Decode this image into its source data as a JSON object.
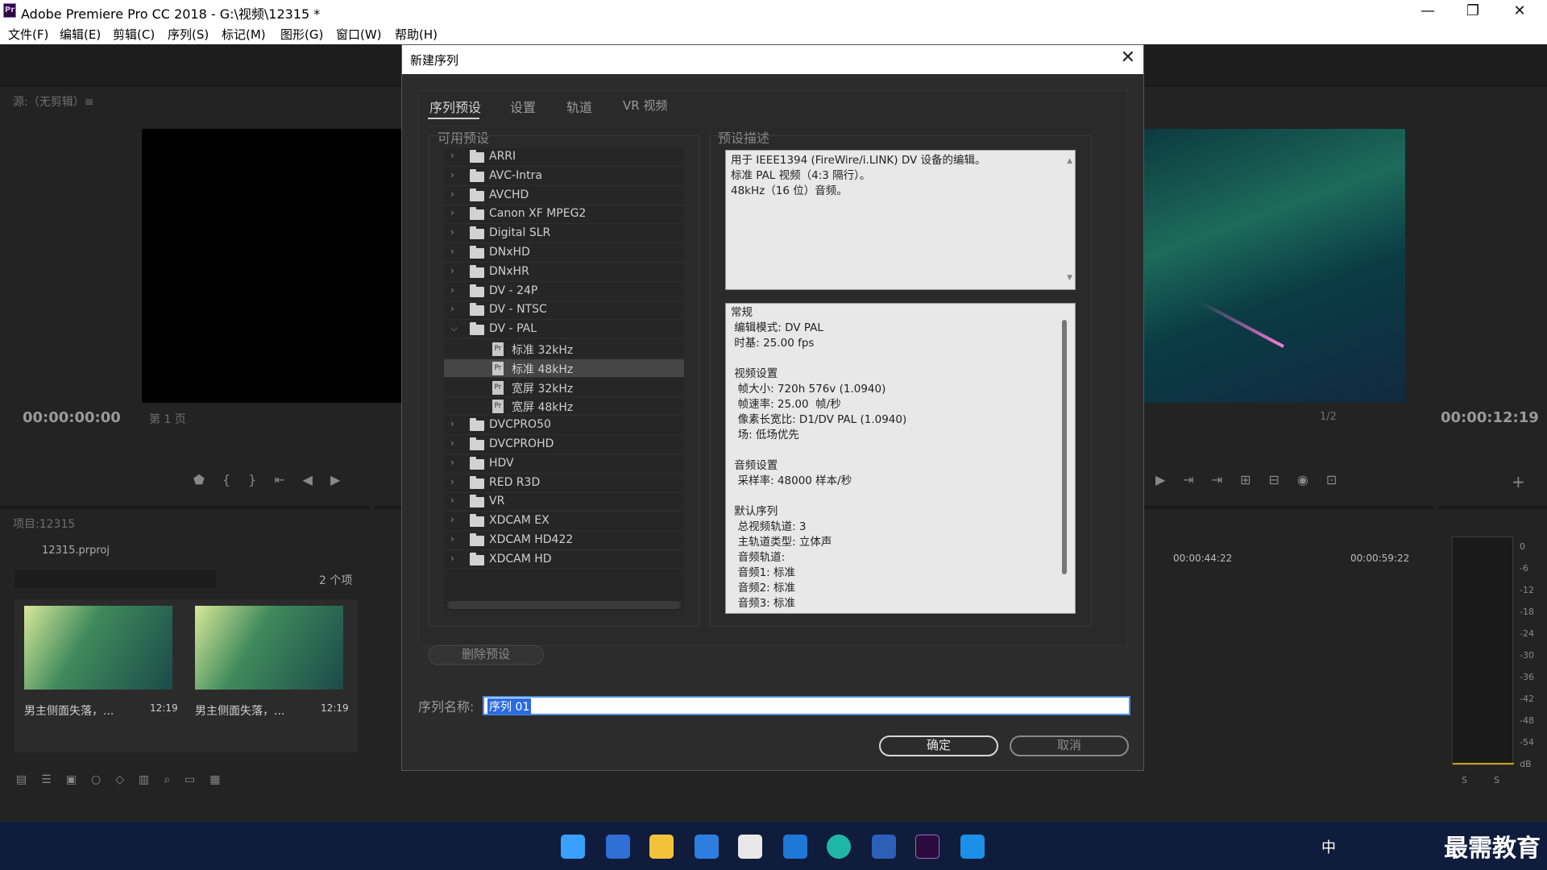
{
  "window": {
    "title": "Adobe Premiere Pro CC 2018 - G:\\视频\\12315 *",
    "logo": "Pr",
    "controls": {
      "minimize": "—",
      "maximize": "❐",
      "close": "✕"
    }
  },
  "menu": [
    "文件(F)",
    "编辑(E)",
    "剪辑(C)",
    "序列(S)",
    "标记(M)",
    "图形(G)",
    "窗口(W)",
    "帮助(H)"
  ],
  "source_panel": {
    "title": "源:（无剪辑）≡",
    "timecode": "00:00:00:00",
    "page": "第 1 页"
  },
  "program_panel": {
    "timecode": "00:00:12:19",
    "zoom": "1/2"
  },
  "project_panel": {
    "title": "项目:12315",
    "file": "12315.prproj",
    "count": "2 个项",
    "clips": [
      {
        "name": "男主侧面失落，...",
        "duration": "12:19"
      },
      {
        "name": "男主侧面失落，...",
        "duration": "12:19"
      }
    ]
  },
  "timeline": {
    "ruler": [
      "00:00:44:22",
      "00:00:59:22"
    ]
  },
  "audio_meter": {
    "scale": [
      "0",
      "-6",
      "-12",
      "-18",
      "-24",
      "-30",
      "-36",
      "-42",
      "-48",
      "-54",
      "dB"
    ],
    "solo": [
      "S",
      "S"
    ]
  },
  "dialog": {
    "title": "新建序列",
    "tabs": [
      "序列预设",
      "设置",
      "轨道",
      "VR 视频"
    ],
    "available_label": "可用预设",
    "desc_label": "预设描述",
    "presets": [
      {
        "label": "ARRI",
        "type": "folder"
      },
      {
        "label": "AVC-Intra",
        "type": "folder"
      },
      {
        "label": "AVCHD",
        "type": "folder"
      },
      {
        "label": "Canon XF MPEG2",
        "type": "folder"
      },
      {
        "label": "Digital SLR",
        "type": "folder"
      },
      {
        "label": "DNxHD",
        "type": "folder"
      },
      {
        "label": "DNxHR",
        "type": "folder"
      },
      {
        "label": "DV - 24P",
        "type": "folder"
      },
      {
        "label": "DV - NTSC",
        "type": "folder"
      },
      {
        "label": "DV - PAL",
        "type": "folder-open"
      },
      {
        "label": "标准 32kHz",
        "type": "preset"
      },
      {
        "label": "标准 48kHz",
        "type": "preset",
        "selected": true
      },
      {
        "label": "宽屏 32kHz",
        "type": "preset"
      },
      {
        "label": "宽屏 48kHz",
        "type": "preset"
      },
      {
        "label": "DVCPRO50",
        "type": "folder"
      },
      {
        "label": "DVCPROHD",
        "type": "folder"
      },
      {
        "label": "HDV",
        "type": "folder"
      },
      {
        "label": "RED R3D",
        "type": "folder"
      },
      {
        "label": "VR",
        "type": "folder"
      },
      {
        "label": "XDCAM EX",
        "type": "folder"
      },
      {
        "label": "XDCAM HD422",
        "type": "folder"
      },
      {
        "label": "XDCAM HD",
        "type": "folder"
      }
    ],
    "description": [
      "用于 IEEE1394 (FireWire/i.LINK) DV 设备的编辑。",
      "标准 PAL 视频（4:3 隔行）。",
      "48kHz（16 位）音频。"
    ],
    "info": [
      "常规",
      " 编辑模式: DV PAL",
      " 时基: 25.00 fps",
      "",
      " 视频设置",
      "  帧大小: 720h 576v (1.0940)",
      "  帧速率: 25.00  帧/秒",
      "  像素长宽比: D1/DV PAL (1.0940)",
      "  场: 低场优先",
      "",
      " 音频设置",
      "  采样率: 48000 样本/秒",
      "",
      " 默认序列",
      "  总视频轨道: 3",
      "  主轨道类型: 立体声",
      "  音频轨道:",
      "  音频1: 标准",
      "  音频2: 标准",
      "  音频3: 标准"
    ],
    "delete_btn": "删除预设",
    "name_label": "序列名称:",
    "name_value": "序列 01",
    "ok": "确定",
    "cancel": "取消"
  },
  "tray": {
    "ime": "中",
    "brand": "最需教育"
  },
  "colors": {
    "accent": "#2b6be0",
    "dialog_bg": "#2c2c2c",
    "taskbar": "#0f1c3c"
  }
}
